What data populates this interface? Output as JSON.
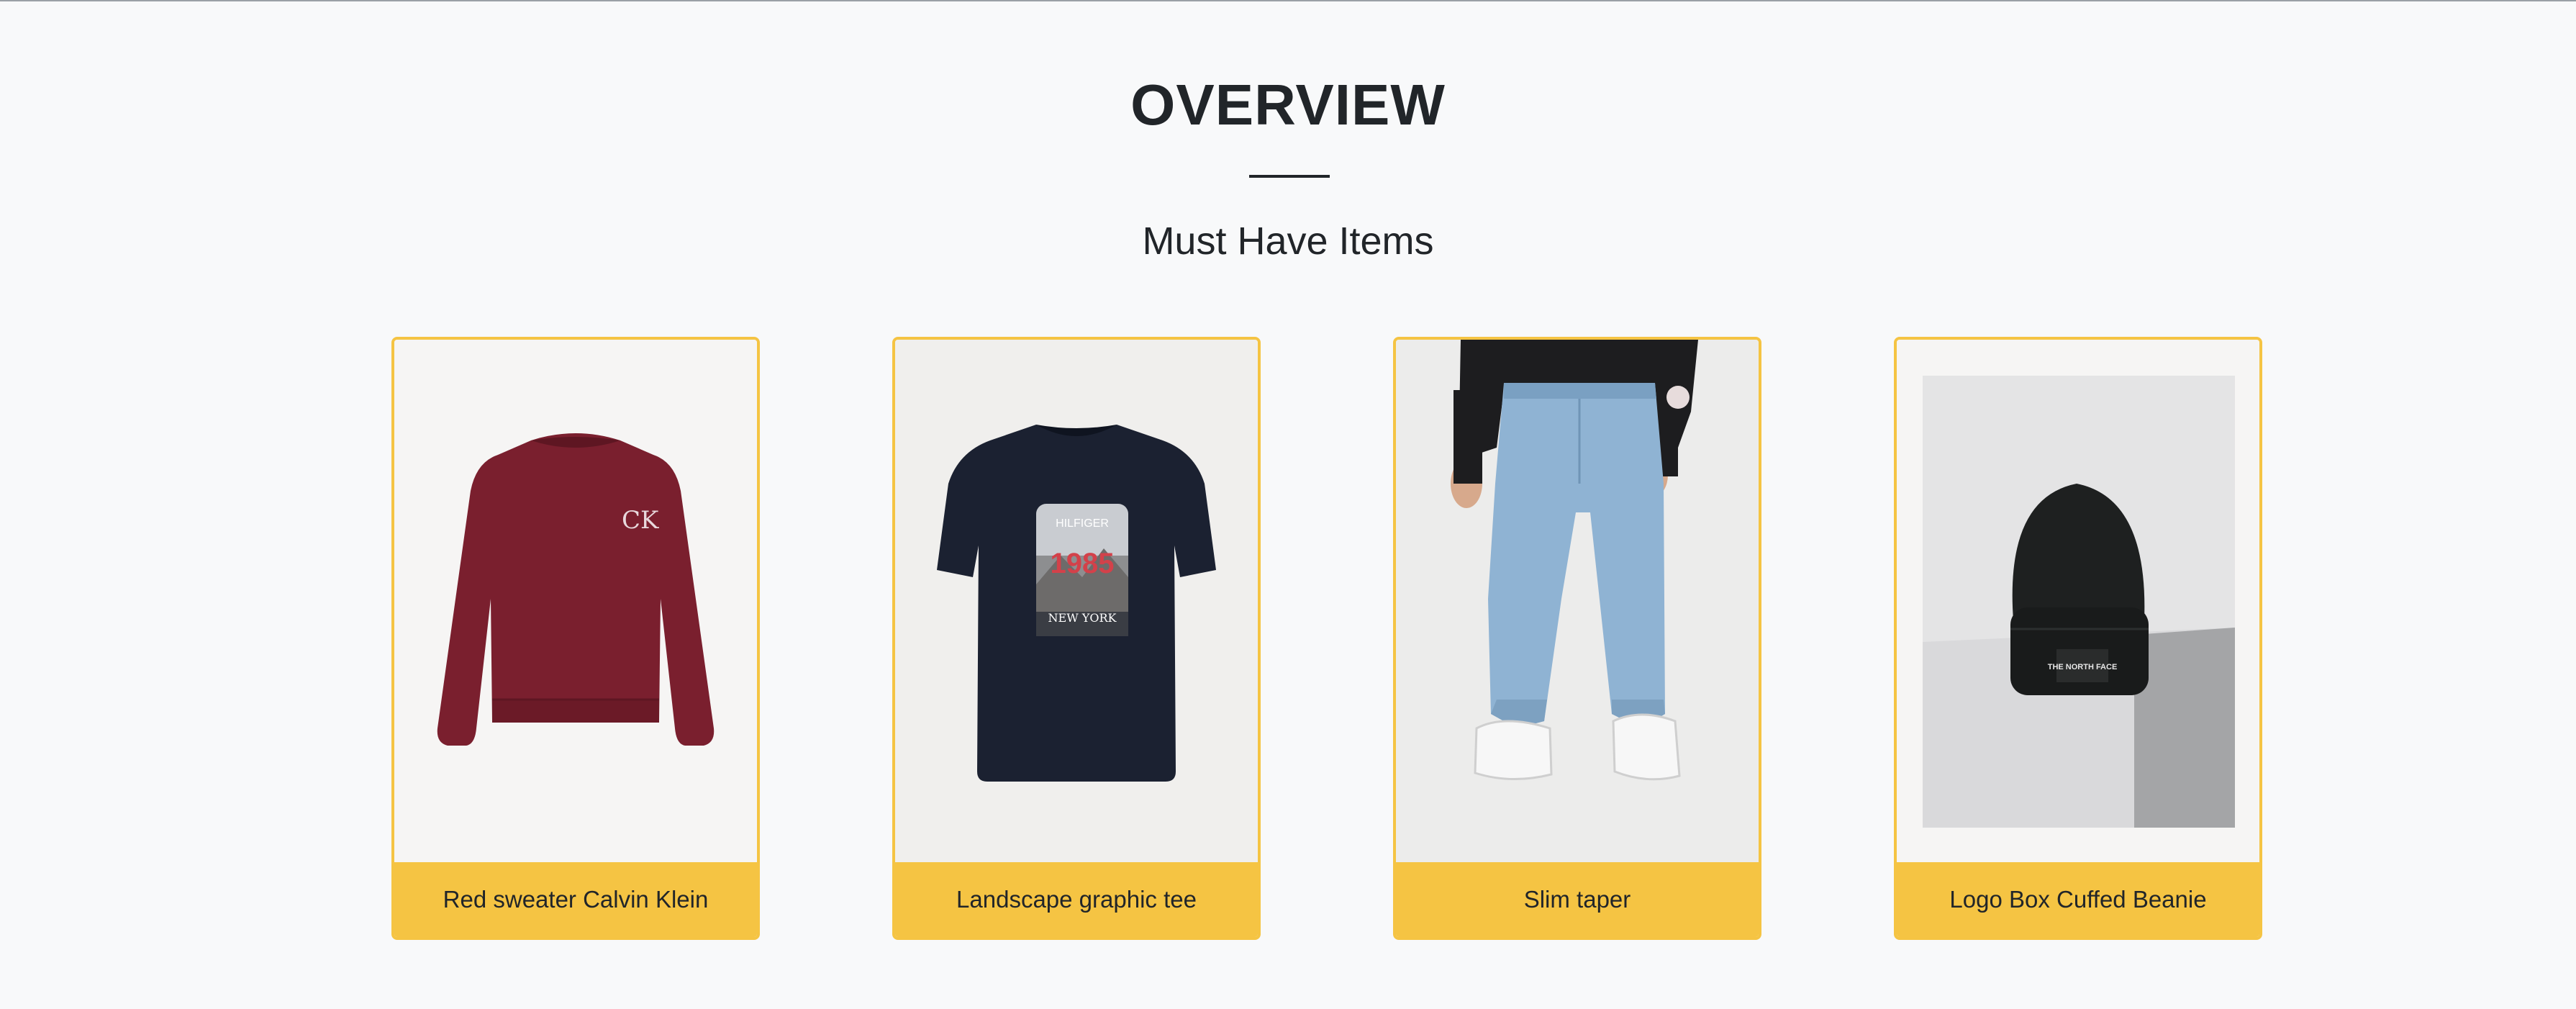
{
  "overview": {
    "title": "OVERVIEW",
    "subtitle": "Must Have Items"
  },
  "products": [
    {
      "name": "Red sweater Calvin Klein",
      "image_icon": "sweater-photo",
      "print": "CK"
    },
    {
      "name": "Landscape graphic tee",
      "image_icon": "tshirt-photo",
      "print_brand": "HILFIGER",
      "print_year": "1985",
      "print_city": "NEW YORK"
    },
    {
      "name": "Slim taper",
      "image_icon": "jeans-photo"
    },
    {
      "name": "Logo Box Cuffed Beanie",
      "image_icon": "beanie-photo",
      "logo": "THE NORTH FACE"
    }
  ],
  "colors": {
    "accent": "#f5c443",
    "background": "#f8f9fa",
    "text": "#212529",
    "sweater": "#7a1f2e",
    "tee": "#1b2131",
    "denim": "#8fb3d3",
    "beanie": "#1e2020"
  }
}
